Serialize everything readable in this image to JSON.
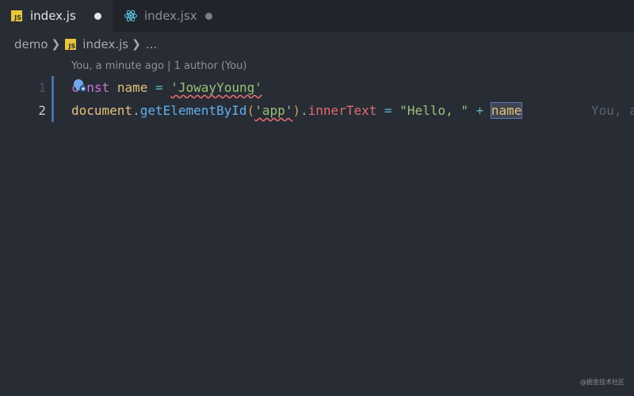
{
  "tabs": [
    {
      "label": "index.js",
      "active": true
    },
    {
      "label": "index.jsx",
      "active": false
    }
  ],
  "breadcrumb": {
    "folder": "demo",
    "file": "index.js",
    "more": "..."
  },
  "codelens": "You, a minute ago | 1 author (You)",
  "lines": [
    {
      "number": "1"
    },
    {
      "number": "2"
    }
  ],
  "code": {
    "l1": {
      "kw": "const",
      "name": "name",
      "eq": "=",
      "str": "'JowayYoung'"
    },
    "l2": {
      "obj": "document",
      "dot1": ".",
      "fn": "getElementById",
      "lparen": "(",
      "arg": "'app'",
      "rparen": ")",
      "dot2": ".",
      "prop": "innerText",
      "eq": "=",
      "str": "\"Hello, \"",
      "plus": "+",
      "name": "name"
    }
  },
  "blame": "You, a",
  "watermark": "@掘金技术社区",
  "colors": {
    "accent": "#4b6fa8",
    "js": "#e8c53c",
    "react": "#61dafb"
  }
}
